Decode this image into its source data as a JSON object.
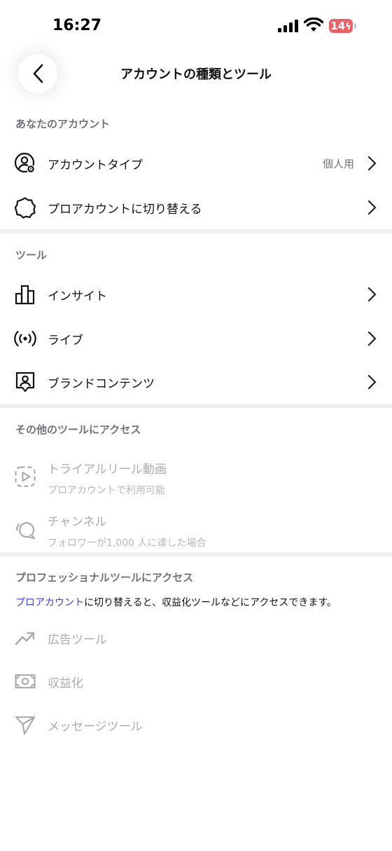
{
  "status_bar": {
    "time": "16:27",
    "battery": "14"
  },
  "header": {
    "title": "アカウントの種類とツール",
    "back_icon": "chevron-left-icon"
  },
  "sections": {
    "your_account": {
      "title": "あなたのアカウント",
      "items": [
        {
          "label": "アカウントタイプ",
          "value": "個人用",
          "icon": "account-settings-icon"
        },
        {
          "label": "プロアカウントに切り替える",
          "icon": "badge-icon"
        }
      ]
    },
    "tools": {
      "title": "ツール",
      "items": [
        {
          "label": "インサイト",
          "icon": "bar-chart-icon"
        },
        {
          "label": "ライブ",
          "icon": "live-broadcast-icon"
        },
        {
          "label": "ブランドコンテンツ",
          "icon": "branded-content-icon"
        }
      ]
    },
    "other_tools": {
      "title": "その他のツールにアクセス",
      "items": [
        {
          "label": "トライアルリール動画",
          "sublabel": "プロアカウントで利用可能",
          "icon": "reel-trial-icon"
        },
        {
          "label": "チャンネル",
          "sublabel": "フォロワーが1,000 人に達した場合",
          "icon": "channel-icon"
        }
      ]
    },
    "pro_tools": {
      "title": "プロフェッショナルツールにアクセス",
      "description_link": "プロアカウント",
      "description_rest": "に切り替えると、収益化ツールなどにアクセスできます。",
      "items": [
        {
          "label": "広告ツール",
          "icon": "trending-up-icon"
        },
        {
          "label": "収益化",
          "icon": "money-icon"
        },
        {
          "label": "メッセージツール",
          "icon": "send-icon"
        }
      ]
    }
  },
  "colors": {
    "accent_link": "#3b43c9",
    "muted_text": "#6e727a",
    "disabled_text": "#a9acb1",
    "divider": "#eef0f2",
    "battery_low": "#e8626a"
  }
}
